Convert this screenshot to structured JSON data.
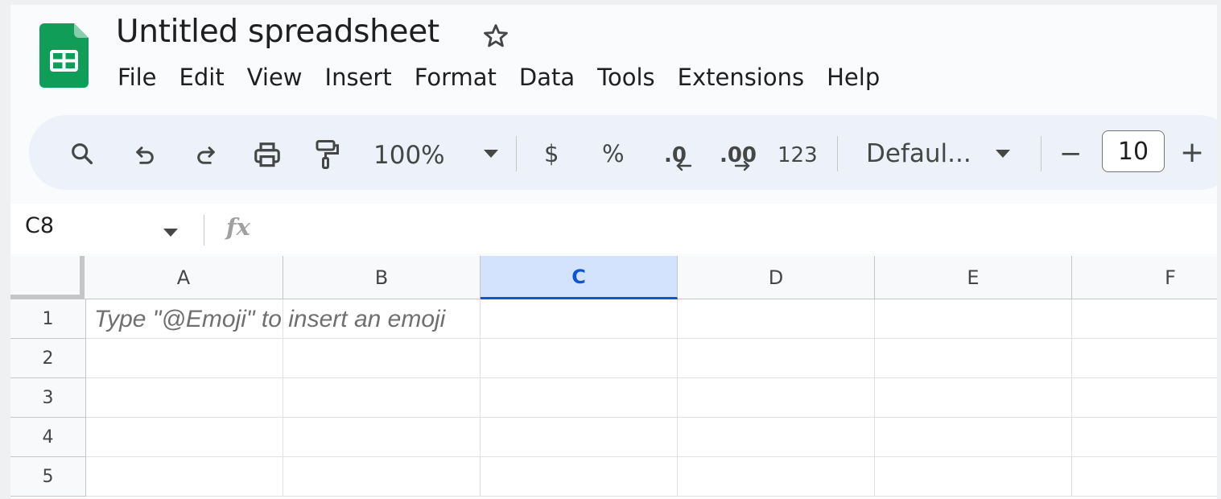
{
  "doc": {
    "title": "Untitled spreadsheet"
  },
  "menu": [
    "File",
    "Edit",
    "View",
    "Insert",
    "Format",
    "Data",
    "Tools",
    "Extensions",
    "Help"
  ],
  "toolbar": {
    "zoom": "100%",
    "currency": "$",
    "percent": "%",
    "decrease_decimal": ".0",
    "increase_decimal": ".00",
    "number_format": "123",
    "font": "Defaul...",
    "font_size": "10",
    "minus": "−",
    "plus": "+"
  },
  "formula_bar": {
    "name_box": "C8",
    "fx": "fx",
    "value": ""
  },
  "grid": {
    "columns": [
      "A",
      "B",
      "C",
      "D",
      "E",
      "F"
    ],
    "selected_column": "C",
    "rows": [
      "1",
      "2",
      "3",
      "4",
      "5"
    ],
    "hint": "Type \"@Emoji\" to insert an emoji"
  },
  "colors": {
    "logo_green": "#0f9d58",
    "selected_header": "#d3e3fd",
    "toolbar_bg": "#edf2fa"
  }
}
